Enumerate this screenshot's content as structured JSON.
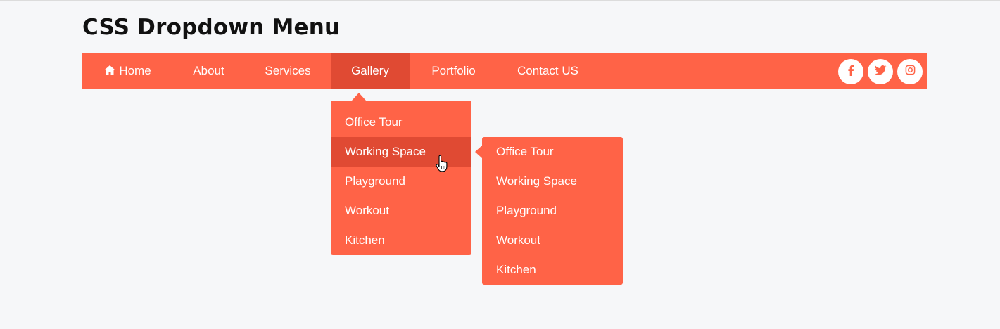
{
  "page": {
    "title": "CSS Dropdown Menu"
  },
  "nav": {
    "items": [
      {
        "label": "Home",
        "icon": "home-icon"
      },
      {
        "label": "About"
      },
      {
        "label": "Services"
      },
      {
        "label": "Gallery",
        "active": true
      },
      {
        "label": "Portfolio"
      },
      {
        "label": "Contact US"
      }
    ],
    "social": [
      {
        "icon": "facebook-icon"
      },
      {
        "icon": "twitter-icon"
      },
      {
        "icon": "instagram-icon"
      }
    ]
  },
  "dropdown": {
    "items": [
      "Office Tour",
      "Working Space",
      "Playground",
      "Workout",
      "Kitchen"
    ],
    "hovered": "Working Space"
  },
  "submenu": {
    "items": [
      "Office Tour",
      "Working Space",
      "Playground",
      "Workout",
      "Kitchen"
    ]
  },
  "colors": {
    "accent": "#ff6347",
    "accent_dark": "#e04a33",
    "background": "#f6f7f9",
    "text_light": "#ffffff",
    "title": "#111111"
  }
}
